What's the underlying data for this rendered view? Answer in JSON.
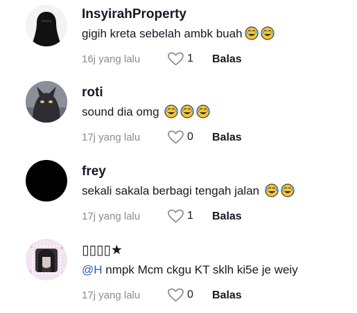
{
  "comments": [
    {
      "username": "InsyirahProperty",
      "mention": "",
      "text": "gigih kreta sebelah ambk buah",
      "emoji_count": 2,
      "emoji": "laughing-tears-emoji",
      "time": "16j yang lalu",
      "likes": "1",
      "reply_label": "Balas",
      "avatar": "hijab-silhouette-avatar"
    },
    {
      "username": "roti",
      "mention": "",
      "text": "sound dia omg ",
      "emoji_count": 3,
      "emoji": "laughing-tears-emoji",
      "time": "17j yang lalu",
      "likes": "0",
      "reply_label": "Balas",
      "avatar": "cat-photo-avatar"
    },
    {
      "username": "frey",
      "mention": "",
      "text": "sekali sakala berbagi tengah jalan ",
      "emoji_count": 2,
      "emoji": "laughing-tears-emoji",
      "time": "17j yang lalu",
      "likes": "1",
      "reply_label": "Balas",
      "avatar": "black-avatar"
    },
    {
      "username": "▯▯▯▯★",
      "mention": "@H",
      "text": " nmpk Mcm ckgu KT sklh ki5e je weiy",
      "emoji_count": 0,
      "emoji": "",
      "time": "17j yang lalu",
      "likes": "0",
      "reply_label": "Balas",
      "avatar": "girl-photo-avatar"
    }
  ],
  "colors": {
    "username": "#161823",
    "meta": "#8a8b91",
    "mention": "#2b5db8",
    "emoji_face": "#f7c531"
  }
}
